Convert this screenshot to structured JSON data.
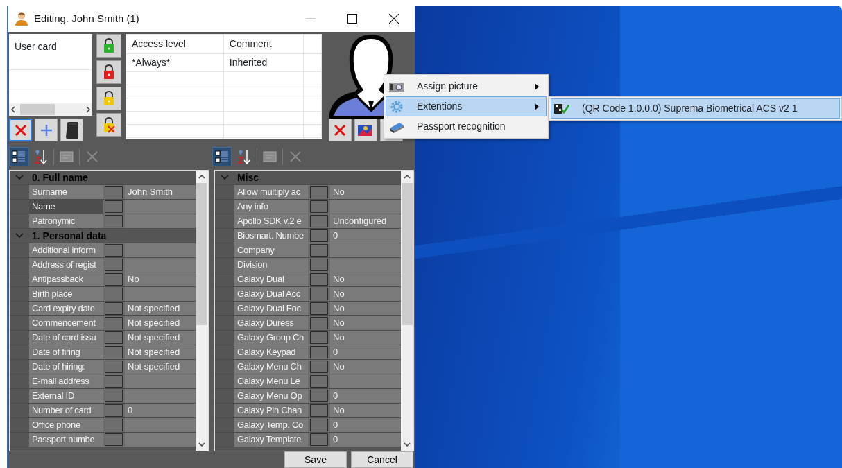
{
  "window": {
    "title": "Editing. John Smith (1)"
  },
  "cards_list": {
    "items": [
      "User card"
    ]
  },
  "card_buttons": [
    {
      "kind": "delete",
      "selected": true
    },
    {
      "kind": "add",
      "selected": false
    },
    {
      "kind": "reader",
      "selected": false
    }
  ],
  "access_table": {
    "columns": [
      "Access level",
      "Comment"
    ],
    "rows": [
      [
        "*Always*",
        "Inherited"
      ]
    ]
  },
  "photo_buttons": [
    {
      "kind": "delete"
    },
    {
      "kind": "picture"
    }
  ],
  "context_menu": {
    "items": [
      {
        "label": "Assign picture",
        "kind": "camera",
        "has_submenu": true,
        "selected": false
      },
      {
        "label": "Extentions",
        "kind": "gear",
        "has_submenu": true,
        "selected": true
      },
      {
        "label": "Passport recognition",
        "kind": "scanner",
        "has_submenu": false,
        "selected": false
      }
    ],
    "submenu": [
      {
        "label": "(QR Code 1.0.0.0) Suprema Biometrical ACS v2 1",
        "selected": true
      }
    ]
  },
  "property_grids": [
    {
      "categorized_selected": true,
      "categories": [
        {
          "title": "0. Full name",
          "expanded": true,
          "rows": [
            {
              "name": "Surname",
              "value": "John Smith",
              "selected": false
            },
            {
              "name": "Name",
              "selected": true
            },
            {
              "name": "Patronymic",
              "selected": false
            }
          ]
        },
        {
          "title": "1. Personal data",
          "expanded": true,
          "rows": [
            {
              "name": "Additional inform",
              "selected": false
            },
            {
              "name": "Address of regist",
              "selected": false
            },
            {
              "name": "Antipassback",
              "value": "No",
              "selected": false
            },
            {
              "name": "Birth place",
              "selected": false
            },
            {
              "name": "Card expiry date",
              "value": "Not specified",
              "selected": false
            },
            {
              "name": "Commencement",
              "value": "Not specified",
              "selected": false
            },
            {
              "name": "Date of card issu",
              "value": "Not specified",
              "selected": false
            },
            {
              "name": "Date of firing",
              "value": "Not specified",
              "selected": false
            },
            {
              "name": "Date of hiring:",
              "value": "Not specified",
              "selected": false
            },
            {
              "name": "E-mail address",
              "selected": false
            },
            {
              "name": "External ID",
              "selected": false
            },
            {
              "name": "Number of card",
              "value": "0",
              "selected": false
            },
            {
              "name": "Office phone",
              "selected": false
            },
            {
              "name": "Passport numbe",
              "selected": false
            }
          ]
        }
      ]
    },
    {
      "categorized_selected": true,
      "categories": [
        {
          "title": "Misc",
          "expanded": true,
          "rows": [
            {
              "name": "Allow multiply ac",
              "value": "No",
              "selected": false
            },
            {
              "name": "Any info",
              "selected": false
            },
            {
              "name": "Apollo SDK v.2 e",
              "value": "Unconfigured",
              "selected": false
            },
            {
              "name": "Biosmart. Numbe",
              "value": "0",
              "selected": false
            },
            {
              "name": "Company",
              "selected": false
            },
            {
              "name": "Division",
              "selected": false
            },
            {
              "name": "Galaxy Dual",
              "value": "No",
              "selected": false
            },
            {
              "name": "Galaxy Dual Acc",
              "value": "No",
              "selected": false
            },
            {
              "name": "Galaxy Dual Foc",
              "value": "No",
              "selected": false
            },
            {
              "name": "Galaxy Duress",
              "value": "No",
              "selected": false
            },
            {
              "name": "Galaxy Group Ch",
              "value": "No",
              "selected": false
            },
            {
              "name": "Galaxy Keypad",
              "value": "0",
              "selected": false
            },
            {
              "name": "Galaxy Menu Ch",
              "value": "No",
              "selected": false
            },
            {
              "name": "Galaxy Menu Le",
              "selected": false
            },
            {
              "name": "Galaxy Menu Op",
              "value": "0",
              "selected": false
            },
            {
              "name": "Galaxy Pin Chan",
              "value": "No",
              "selected": false
            },
            {
              "name": "Galaxy Temp. Co",
              "value": "0",
              "selected": false
            },
            {
              "name": "Galaxy Template",
              "value": "0",
              "selected": false
            }
          ]
        }
      ]
    }
  ],
  "buttons": [
    "Save",
    "Cancel"
  ]
}
